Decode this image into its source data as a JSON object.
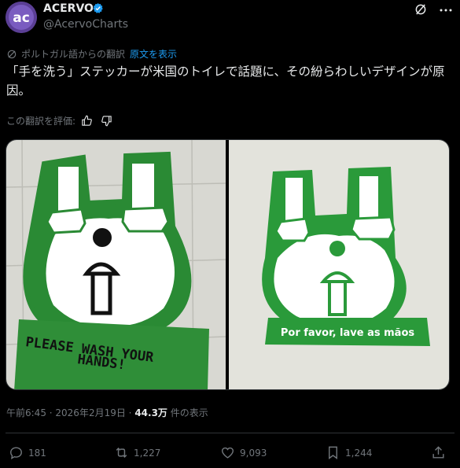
{
  "author": {
    "avatar_text": "ac",
    "name": "ACERVO",
    "handle": "@AcervoCharts"
  },
  "translation": {
    "notice": "ポルトガル語からの翻訳",
    "show_original": "原文を表示"
  },
  "tweet": {
    "text": "「手を洗う」ステッカーが米国のトイレで話題に、その紛らわしいデザインが原因。"
  },
  "rating": {
    "label": "この翻訳を評価:"
  },
  "media": {
    "left_sticker_text": [
      "PLEASE WASH YOUR",
      "HANDS!"
    ],
    "right_sticker_text": "Por favor, lave as mãos"
  },
  "meta": {
    "time": "午前6:45",
    "separator1": " · ",
    "date": "2026年2月19日",
    "separator2": " · ",
    "views": "44.3万",
    "views_label": " 件の表示"
  },
  "actions": {
    "replies": "181",
    "reposts": "1,227",
    "likes": "9,093",
    "bookmarks": "1,244"
  },
  "colors": {
    "accent": "#1d9bf0",
    "sticker_green": "#2e8b35",
    "background": "#000000"
  }
}
